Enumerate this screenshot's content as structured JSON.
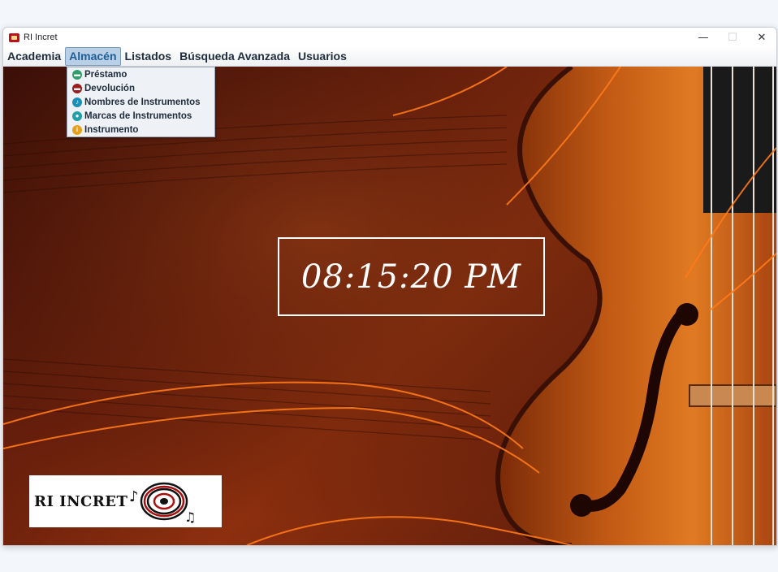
{
  "window": {
    "title": "RI Incret",
    "controls": {
      "minimize": "—",
      "maximize": "☐",
      "close": "✕"
    }
  },
  "menubar": {
    "items": [
      {
        "label": "Academia"
      },
      {
        "label": "Almacén",
        "active": true
      },
      {
        "label": "Listados"
      },
      {
        "label": "Búsqueda Avanzada"
      },
      {
        "label": "Usuarios"
      }
    ]
  },
  "dropdown": {
    "items": [
      {
        "label": "Préstamo",
        "icon": "green-circle-icon",
        "color": "#2e9f6b",
        "glyph": "▬"
      },
      {
        "label": "Devolución",
        "icon": "red-circle-icon",
        "color": "#9b1c1c",
        "glyph": "▬"
      },
      {
        "label": "Nombres de Instrumentos",
        "icon": "music-note-icon",
        "color": "#1b8fb5",
        "glyph": "♪"
      },
      {
        "label": "Marcas de Instrumentos",
        "icon": "tag-icon",
        "color": "#1fa0a8",
        "glyph": "●"
      },
      {
        "label": "Instrumento",
        "icon": "info-icon",
        "color": "#e4a11b",
        "glyph": "i"
      }
    ]
  },
  "clock": {
    "time": "08:15:20 PM"
  },
  "logo": {
    "text": "RI INCRET"
  }
}
